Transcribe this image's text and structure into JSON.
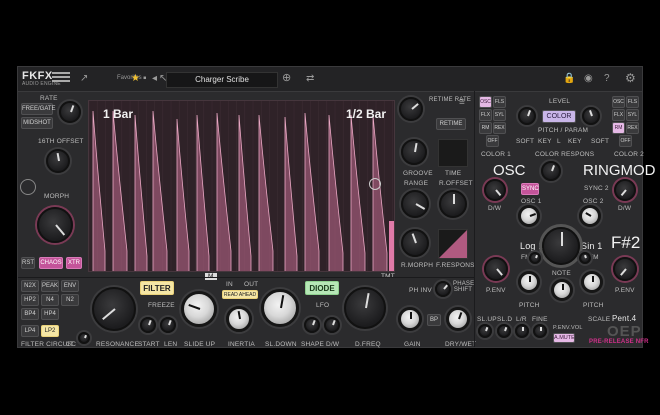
{
  "header": {
    "logo_text": "FKFX",
    "logo_sub": "AUDIO ENGINE",
    "favorites_label": "Favorites",
    "preset_name": "Charger Scribe",
    "star_icon": "star-icon"
  },
  "left_column": {
    "rate_label": "RATE",
    "free_gate_label": "FREE/GATE",
    "midshot_label": "MIDSHOT",
    "offset_label": "16TH OFFSET",
    "morph_label": "MORPH",
    "rst_label": "RST",
    "chaos_label": "CHAOS",
    "xtr_label": "XTR"
  },
  "waveform": {
    "left_marker": "1 Bar",
    "right_marker": "1/2 Bar",
    "bottom_tag": "TMT",
    "mode_tag": "M",
    "color": "#c06a8e"
  },
  "retime": {
    "rate_label": "RETIME RATE",
    "retime_button": "RETIME",
    "groove_label": "GROOVE",
    "time_label": "TIME",
    "range_label": "RANGE",
    "roffset_label": "R.OFFSET",
    "rmorph_label": "R.MORPH",
    "fresponse_label": "F.RESPONS"
  },
  "bottom": {
    "filter_label": "FILTER",
    "freeze_label": "FREEZE",
    "in_label": "IN",
    "out_label": "OUT",
    "read_ahead_label": "READ AHEAD",
    "diode_label": "DIODE",
    "lfo_label": "LFO",
    "ph_inv_label": "PH INV",
    "phase_shift_label": "PHASE SHIFT",
    "filter_types": [
      "N2X",
      "PEAK",
      "ENV",
      "HP2",
      "N4",
      "N2",
      "BP4",
      "HP4",
      "LP4",
      "LP2"
    ],
    "filter_circuit_label": "FILTER CIRCUIT",
    "gc_label": "GC",
    "resonance_label": "RESONANCE",
    "start_label": "START",
    "len_label": "LEN",
    "slide_up_label": "SLIDE UP",
    "inertia_label": "INERTIA",
    "sl_down_label": "SL.DOWN",
    "shape_label": "SHAPE",
    "dw_label": "D/W",
    "dfreq_label": "D.FREQ",
    "gain_label": "GAIN",
    "dry_wet_label": "DRY/WET",
    "bp_label": "BP"
  },
  "synth": {
    "osc_tabs": [
      "OSC",
      "FLS",
      "FLX",
      "SYL",
      "RM",
      "REX",
      "OFF"
    ],
    "level_label": "LEVEL",
    "color_button": "COLOR",
    "pitch_param_label": "PITCH / PARAM",
    "key_label": "KEY",
    "l_label": "L",
    "soft_label": "SOFT",
    "color1_label": "COLOR 1",
    "color_respons_label": "COLOR RESPONS",
    "color2_label": "COLOR 2",
    "osc_title": "OSC",
    "ringmod_title": "RINGMOD",
    "sync_label": "SYNC",
    "sync2_label": "SYNC 2",
    "osc1_label": "OSC 1",
    "osc2_label": "OSC 2",
    "dw_label": "D/W",
    "log_label": "Log 1",
    "sin_label": "Sin 1",
    "fm_label": "FM",
    "note_name": "F#2",
    "note_label": "NOTE",
    "penv_label": "P.ENV",
    "pitch_label": "PITCH",
    "slup_label": "SL.UP",
    "sld_label": "SL.D",
    "lr_label": "L/R",
    "fine_label": "FINE",
    "scale_label": "SCALE",
    "penv_vol_label": "P.ENV.VOL",
    "amute_label": "A.MUTE",
    "scale_value": "Pent.4",
    "brand": "OEP",
    "release_tag": "PRE-RELEASE NFR"
  }
}
